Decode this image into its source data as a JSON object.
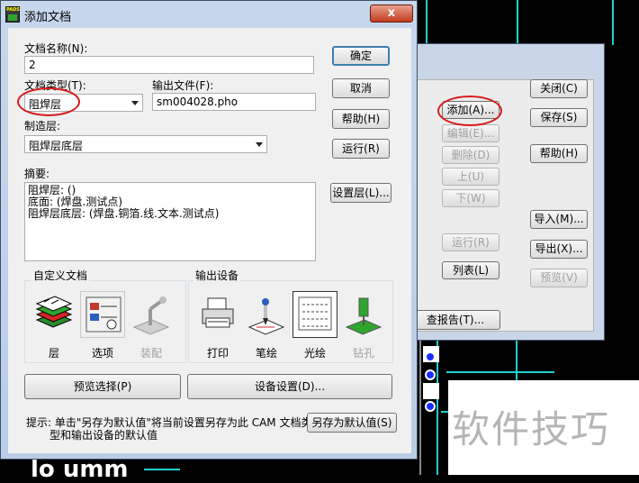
{
  "dialog": {
    "title": "添加文档",
    "logo_text": "PADS",
    "close_label": "x",
    "doc_name_label": "文档名称(N):",
    "doc_name_value": "2",
    "doc_type_label": "文档类型(T):",
    "doc_type_value": "阻焊层",
    "output_file_label": "输出文件(F):",
    "output_file_value": "sm004028.pho",
    "fab_layer_label": "制造层:",
    "fab_layer_value": "阻焊层底层",
    "summary_label": "摘要:",
    "summary_lines": [
      "阻焊层: ()",
      "底面: (焊盘.测试点)",
      "阻焊层底层: (焊盘.铜箔.线.文本.测试点)"
    ],
    "buttons": {
      "ok": "确定",
      "cancel": "取消",
      "help": "帮助(H)",
      "run": "运行(R)",
      "layers": "设置层(L)...",
      "preview": "预览选择(P)",
      "device": "设备设置(D)...",
      "save_default": "另存为默认值(S)"
    },
    "custom_docs_label": "自定义文档",
    "output_devices_label": "输出设备",
    "custom_doc_icons": [
      {
        "label": "层",
        "icon": "layers-icon",
        "enabled": true
      },
      {
        "label": "选项",
        "icon": "options-icon",
        "enabled": true
      },
      {
        "label": "装配",
        "icon": "assembly-icon",
        "enabled": false
      }
    ],
    "device_icons": [
      {
        "label": "打印",
        "icon": "printer-icon",
        "enabled": true
      },
      {
        "label": "笔绘",
        "icon": "pen-plotter-icon",
        "enabled": true
      },
      {
        "label": "光绘",
        "icon": "photoplot-icon",
        "enabled": true,
        "selected": true
      },
      {
        "label": "钻孔",
        "icon": "drill-icon",
        "enabled": false
      }
    ],
    "hint_line1": "提示: 单击\"另存为默认值\"将当前设置另存为此 CAM 文档类",
    "hint_line2": "型和输出设备的默认值"
  },
  "back_dialog": {
    "buttons_left": [
      {
        "label": "添加(A)...",
        "enabled": true
      },
      {
        "label": "编辑(E)...",
        "enabled": false
      },
      {
        "label": "删除(D)",
        "enabled": false
      },
      {
        "label": "上(U)",
        "enabled": false
      },
      {
        "label": "下(W)",
        "enabled": false
      },
      {
        "label": "运行(R)",
        "enabled": false
      },
      {
        "label": "列表(L)",
        "enabled": true
      }
    ],
    "buttons_right": [
      {
        "label": "关闭(C)",
        "enabled": true
      },
      {
        "label": "保存(S)",
        "enabled": true
      },
      {
        "label": "帮助(H)",
        "enabled": true
      },
      {
        "label": "导入(M)...",
        "enabled": true
      },
      {
        "label": "导出(X)...",
        "enabled": true
      },
      {
        "label": "预览(V)",
        "enabled": false
      }
    ],
    "report_button": "查报告(T)..."
  },
  "background": {
    "pcb_text": "lo umm",
    "watermark": "软件技巧"
  },
  "colors": {
    "pcb_background": "#000000",
    "trace": "#1fd0d0",
    "annotation_ring": "#d81a1a",
    "title_bar": "#c7d7ec"
  }
}
